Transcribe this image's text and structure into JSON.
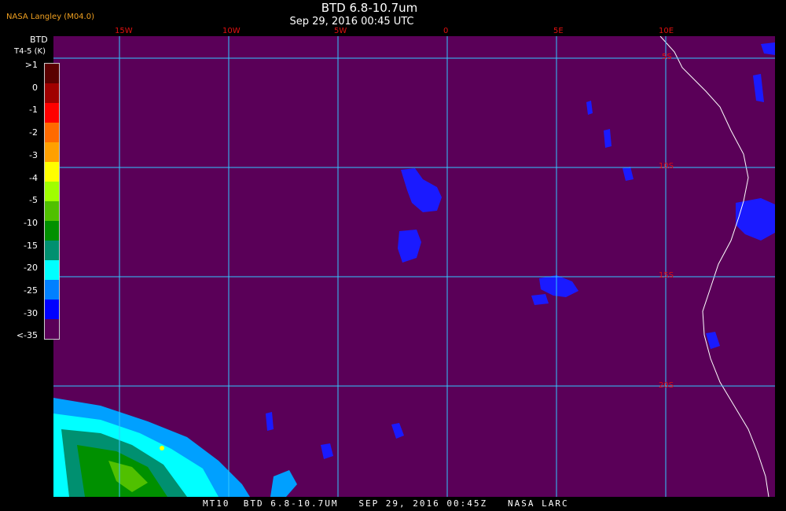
{
  "header": {
    "title": "BTD 6.8-10.7um",
    "datetime": "Sep 29, 2016 00:45 UTC",
    "producer": "NASA Langley (M04.0)"
  },
  "legend": {
    "title": "BTD",
    "units": "T4-5 (K)",
    "items": [
      {
        "label": ">1",
        "color": "#5a0000"
      },
      {
        "label": "0",
        "color": "#a00000"
      },
      {
        "label": "-1",
        "color": "#ff0000"
      },
      {
        "label": "-2",
        "color": "#ff6a00"
      },
      {
        "label": "-3",
        "color": "#ffa000"
      },
      {
        "label": "-4",
        "color": "#ffff00"
      },
      {
        "label": "-5",
        "color": "#a0ff00"
      },
      {
        "label": "-10",
        "color": "#50c000"
      },
      {
        "label": "-15",
        "color": "#009000"
      },
      {
        "label": "-20",
        "color": "#009070"
      },
      {
        "label": "-25",
        "color": "#00ffff"
      },
      {
        "label": "-30",
        "color": "#0080ff"
      },
      {
        "label": "<-35",
        "color": "#0000ff"
      }
    ],
    "extra_color": "#5a0058"
  },
  "grid": {
    "longitudes": [
      "15W",
      "10W",
      "5W",
      "0",
      "5E",
      "10E"
    ],
    "latitudes": [
      "5S",
      "10S",
      "15S",
      "20S"
    ]
  },
  "footer": {
    "text": "MT10  BTD 6.8-10.7UM   SEP 29, 2016 00:45Z   NASA LARC"
  },
  "colors": {
    "background": "#5a0058",
    "grid": "#33c8ff",
    "coast": "#ffffff",
    "labels": "#e01010"
  }
}
